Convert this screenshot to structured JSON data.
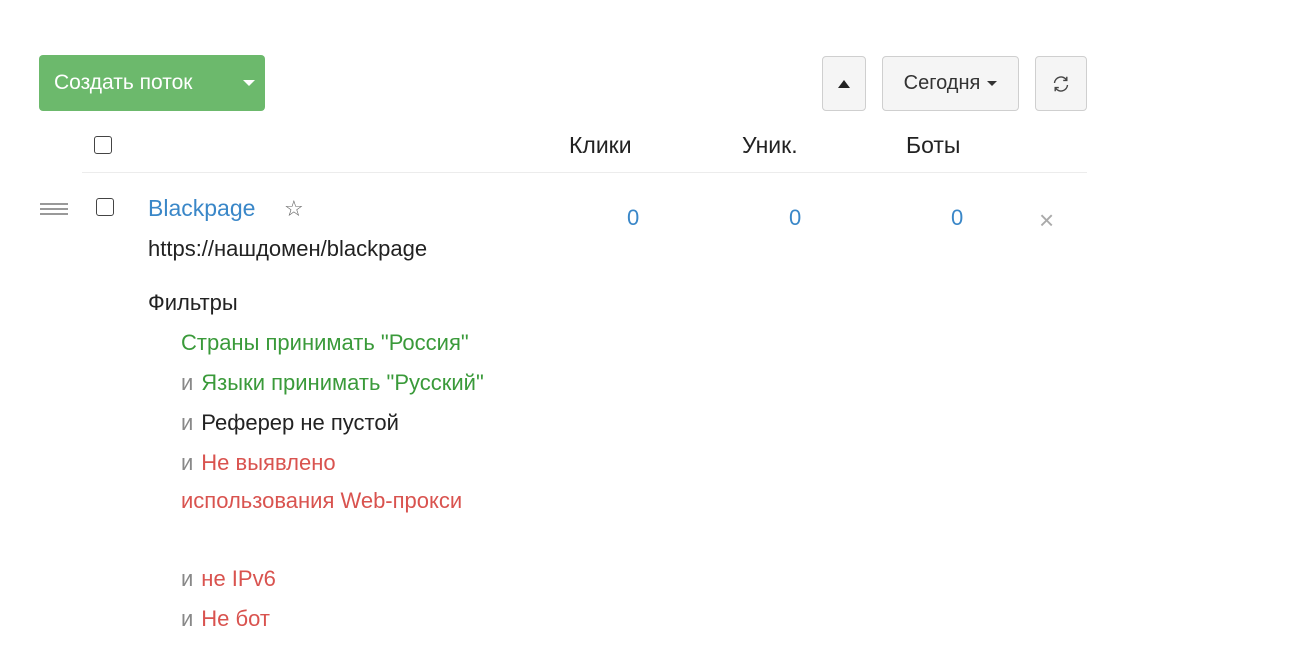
{
  "toolbar": {
    "create_label": "Создать поток",
    "period_label": "Сегодня"
  },
  "columns": {
    "clicks": "Клики",
    "unique": "Уник.",
    "bots": "Боты"
  },
  "flow": {
    "name": "Blackpage",
    "star_glyph": "☆",
    "url": "https://нашдомен/blackpage",
    "clicks": "0",
    "unique": "0",
    "bots": "0",
    "delete_glyph": "×"
  },
  "filters": {
    "title": "Фильтры",
    "conjunction": "и",
    "items": [
      "Страны принимать \"Россия\"",
      "Языки принимать \"Русский\"",
      "Реферер не пустой",
      "Не выявлено использования Web-прокси",
      "не IPv6",
      "Не бот"
    ]
  },
  "colors": {
    "accent_green": "#6cb96c",
    "link_blue": "#3a87c8",
    "filter_green": "#3a9a3a",
    "filter_red": "#d9534f"
  },
  "icons": {
    "up": "caret-up-icon",
    "dropdown": "caret-down-icon",
    "refresh": "refresh-icon",
    "drag": "drag-handle-icon",
    "favorite": "star-icon",
    "delete": "close-icon"
  }
}
